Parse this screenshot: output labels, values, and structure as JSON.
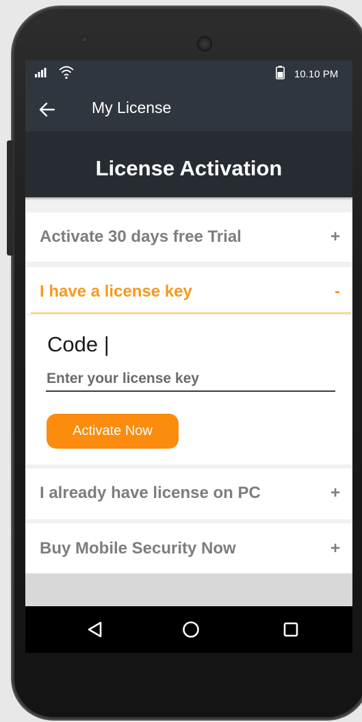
{
  "status_bar": {
    "time": "10.10 PM",
    "icons": [
      "signal-icon",
      "wifi-icon",
      "battery-icon"
    ]
  },
  "app_bar": {
    "title": "My License",
    "back_icon": "back-arrow-icon"
  },
  "header": {
    "title": "License Activation"
  },
  "accordion": {
    "trial": {
      "label": "Activate 30 days free Trial",
      "sign": "+"
    },
    "license_key": {
      "label": "I have a license key",
      "sign": "-",
      "code_label": "Code |",
      "input_placeholder": "Enter your license key",
      "input_value": "",
      "button_label": "Activate Now"
    },
    "pc": {
      "label": "I already have license on PC",
      "sign": "+"
    },
    "buy": {
      "label": "Buy Mobile Security Now",
      "sign": "+"
    }
  },
  "nav_bar": {
    "icons": [
      "nav-back-icon",
      "nav-home-icon",
      "nav-recent-icon"
    ]
  },
  "colors": {
    "accent": "#fb8c0e",
    "accent_text": "#f59a1d",
    "app_bar": "#30363d",
    "header_band": "#262c31",
    "row_text": "#7d7d7d"
  }
}
